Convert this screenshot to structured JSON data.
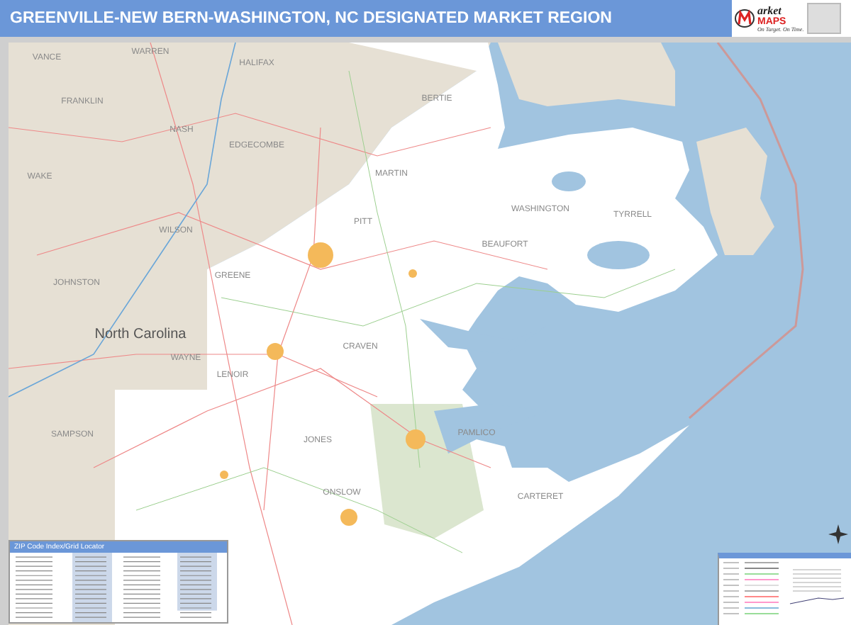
{
  "header": {
    "title": "GREENVILLE-NEW BERN-WASHINGTON, NC DESIGNATED MARKET REGION"
  },
  "logo": {
    "word": "arket",
    "brand": "MAPS",
    "tagline": "On Target. On Time."
  },
  "map": {
    "labels": [
      {
        "text": "VANCE",
        "kind": "county"
      },
      {
        "text": "WARREN",
        "kind": "county"
      },
      {
        "text": "HALIFAX",
        "kind": "county"
      },
      {
        "text": "FRANKLIN",
        "kind": "county"
      },
      {
        "text": "NASH",
        "kind": "county"
      },
      {
        "text": "EDGECOMBE",
        "kind": "county"
      },
      {
        "text": "WAKE",
        "kind": "county"
      },
      {
        "text": "MARTIN",
        "kind": "county"
      },
      {
        "text": "BERTIE",
        "kind": "county"
      },
      {
        "text": "WILSON",
        "kind": "county"
      },
      {
        "text": "PITT",
        "kind": "county"
      },
      {
        "text": "GREENE",
        "kind": "county"
      },
      {
        "text": "JOHNSTON",
        "kind": "county"
      },
      {
        "text": "North Carolina",
        "kind": "state"
      },
      {
        "text": "WAYNE",
        "kind": "county"
      },
      {
        "text": "CRAVEN",
        "kind": "county"
      },
      {
        "text": "LENOIR",
        "kind": "county"
      },
      {
        "text": "SAMPSON",
        "kind": "county"
      },
      {
        "text": "JONES",
        "kind": "county"
      },
      {
        "text": "ONSLOW",
        "kind": "county"
      },
      {
        "text": "WASHINGTON",
        "kind": "county"
      },
      {
        "text": "TYRRELL",
        "kind": "county"
      },
      {
        "text": "BEAUFORT",
        "kind": "county"
      },
      {
        "text": "PAMLICO",
        "kind": "county"
      },
      {
        "text": "CARTERET",
        "kind": "county"
      }
    ]
  },
  "index_panel": {
    "title": "ZIP Code Index/Grid Locator"
  }
}
